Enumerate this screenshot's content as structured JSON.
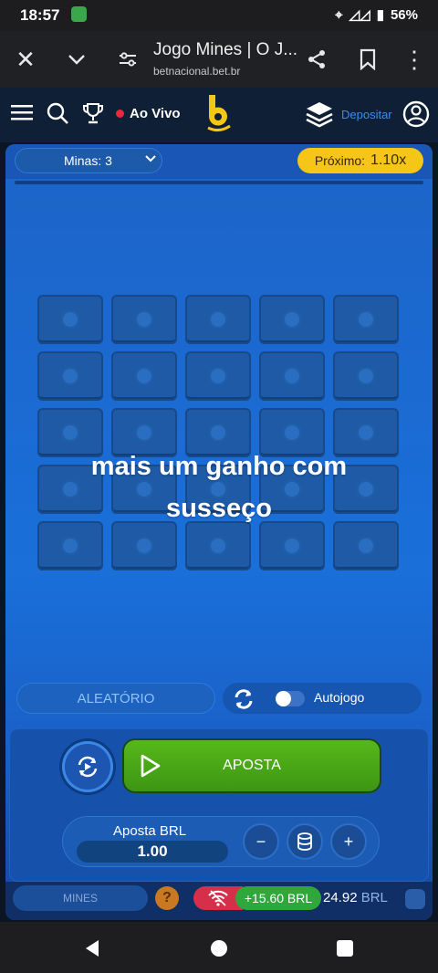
{
  "status_bar": {
    "time": "18:57",
    "battery": "56%"
  },
  "browser": {
    "title": "Jogo Mines | O J...",
    "url": "betnacional.bet.br"
  },
  "site_header": {
    "live_label": "Ao Vivo",
    "deposit_label": "Depositar",
    "brand_color": "#f5c518"
  },
  "game": {
    "mines_label": "Minas: 3",
    "next_label": "Próximo:",
    "next_value": "1.10x",
    "grid": {
      "rows": 5,
      "cols": 5
    },
    "overlay_text_line1": "mais um ganho com",
    "overlay_text_line2": "susseço",
    "random_label": "ALEATÓRIO",
    "autoplay_label": "Autojogo",
    "autoplay_enabled": false,
    "bet_button_label": "APOSTA",
    "stake_label": "Aposta BRL",
    "stake_value": "1.00",
    "minus_label": "−",
    "plus_label": "+",
    "game_name": "MINES",
    "win_badge": "+15.60 BRL",
    "balance_value": "24.92",
    "balance_currency": "BRL"
  }
}
